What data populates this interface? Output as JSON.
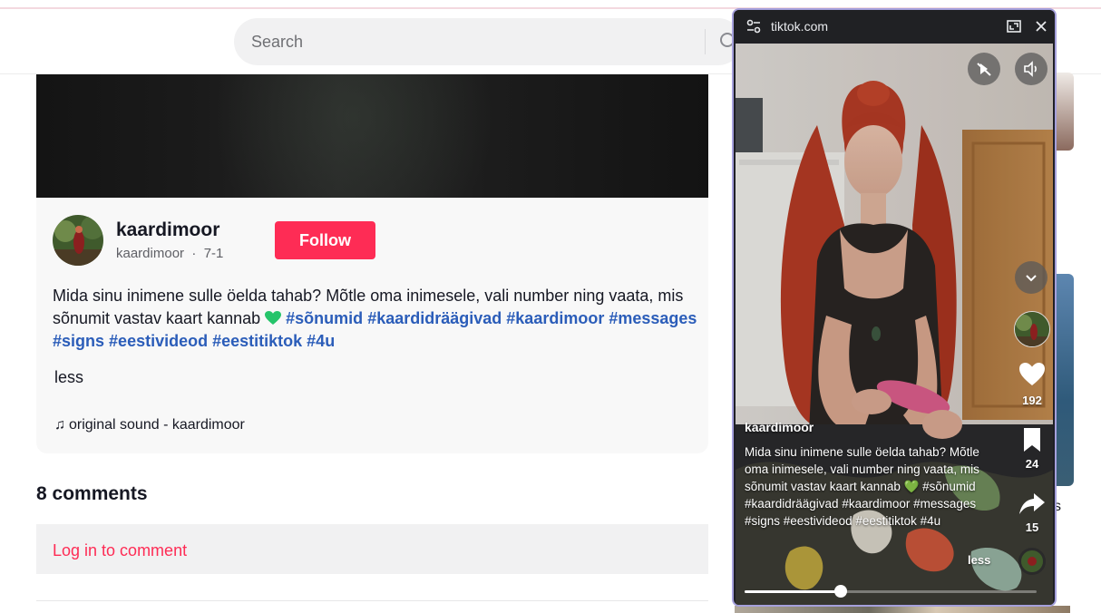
{
  "search": {
    "placeholder": "Search"
  },
  "post": {
    "author": "kaardimoor",
    "handle": "kaardimoor",
    "date": "7-1",
    "follow_label": "Follow",
    "caption_text": "Mida sinu inimene sulle öelda tahab? Mõtle oma inimesele, vali number ning vaata, mis sõnumit vastav kaart kannab",
    "hashtags": [
      "#sõnumid",
      "#kaardidräägivad",
      "#kaardimoor",
      "#messages",
      "#signs",
      "#eestivideod",
      "#eestitiktok",
      "#4u"
    ],
    "less_label": "less",
    "sound": "original sound - kaardimoor"
  },
  "comments": {
    "title": "8 comments",
    "login_label": "Log in to comment"
  },
  "popup": {
    "url": "tiktok.com",
    "overlay_author": "kaardimoor",
    "overlay_caption": "Mida sinu inimene sulle öelda tahab? Mõtle oma inimesele, vali number ning vaata, mis sõnumit vastav kaart kannab 💚 #sõnumid #kaardidräägivad #kaardimoor #messages #signs #eestivideod #eestitiktok #4u",
    "overlay_less": "less",
    "likes": "192",
    "saves": "24",
    "shares": "15",
    "progress": 0.33
  },
  "peek_text": "s",
  "colors": {
    "accent": "#fe2c55",
    "hashtag": "#2b5db9",
    "heart_green": "#25c46a",
    "popup_border": "#a5a0dc"
  },
  "icons": [
    "search-icon",
    "kebab-icon",
    "note-icon",
    "heart-emoji",
    "site-settings-icon",
    "expand-icon",
    "close-icon",
    "no-autoplay-icon",
    "volume-icon",
    "chevron-down-icon",
    "like-icon",
    "bookmark-icon",
    "share-icon",
    "music-disc-icon"
  ]
}
